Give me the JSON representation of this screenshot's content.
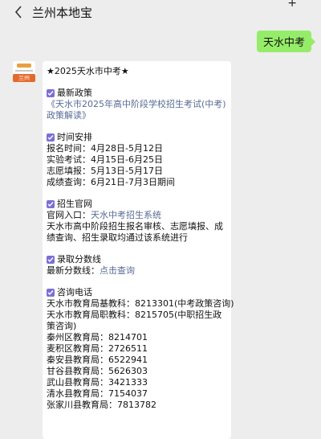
{
  "header": {
    "title": "兰州本地宝",
    "back_icon": "chevron-left-icon",
    "more_icon": "more-icon"
  },
  "user_message": "天水中考",
  "avatar": {
    "badge": "兰州"
  },
  "card": {
    "title": "★2025天水市中考★",
    "policy": {
      "heading": "最新政策",
      "link": "《天水市2025年高中阶段学校招生考试(中考)政策解读》"
    },
    "schedule": {
      "heading": "时间安排",
      "items": [
        "报名时间：4月28日-5月12日",
        "实验考试：4月15日-6月25日",
        "志愿填报：5月13日-5月17日",
        "成绩查询：6月21日-7月3日期间"
      ]
    },
    "website": {
      "heading": "招生官网",
      "entry_label": "官网入口：",
      "entry_link": "天水中考招生系统",
      "desc": "天水市高中阶段招生报名审核、志愿填报、成绩查询、招生录取均通过该系统进行"
    },
    "scores": {
      "heading": "录取分数线",
      "label": "最新分数线：",
      "link": "点击查询"
    },
    "phones": {
      "heading": "咨询电话",
      "items": [
        "天水市教育局基教科：8213301(中考政策咨询)",
        "天水市教育局职教科：8215705(中职招生政策咨询)",
        "秦州区教育局：8214701",
        "麦积区教育局：2726511",
        "秦安县教育局：6522941",
        "甘谷县教育局：5626303",
        "武山县教育局：3421333",
        "清水县教育局：7154037",
        "张家川县教育局：7813782"
      ]
    }
  },
  "colors": {
    "bubble": "#95ec69",
    "link": "#576b95",
    "check": "#7b6fd6"
  }
}
